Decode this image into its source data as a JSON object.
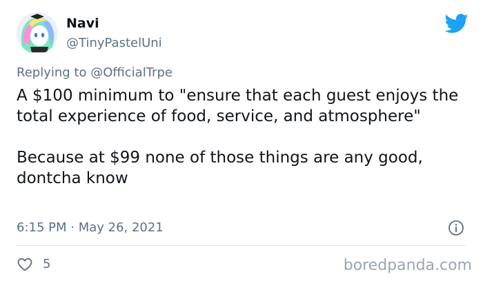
{
  "tweet": {
    "author": {
      "display_name": "Navi",
      "handle": "@TinyPastelUni",
      "avatar_icon": "avatar-cartoon-pastel-unicorn"
    },
    "brand_icon": "twitter-bird-icon",
    "reply_prefix": "Replying to ",
    "reply_to": "@OfficialTrpe",
    "body_paragraphs": [
      "A $100 minimum to \"ensure that each guest enjoys the total experience of food, service, and atmosphere\"",
      "Because at $99 none of those things are any good, dontcha know"
    ],
    "timestamp": "6:15 PM · May 26, 2021",
    "info_icon": "info-circle-icon",
    "like_icon": "heart-outline-icon",
    "like_count": "5"
  },
  "watermark": "boredpanda.com",
  "colors": {
    "text_primary": "#0f1419",
    "text_secondary": "#5b7083",
    "twitter_blue": "#1da1f2",
    "divider": "#dbe2e8",
    "watermark": "#9aa6b1"
  }
}
